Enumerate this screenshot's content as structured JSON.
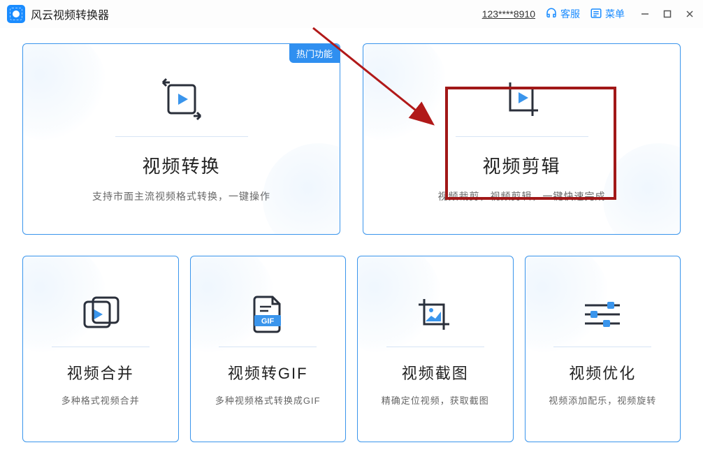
{
  "app": {
    "title": "风云视频转换器"
  },
  "header": {
    "phone": "123****8910",
    "service": "客服",
    "menu": "菜单"
  },
  "cards": {
    "convert": {
      "badge": "热门功能",
      "title": "视频转换",
      "desc": "支持市面主流视频格式转换，一键操作"
    },
    "edit": {
      "title": "视频剪辑",
      "desc": "视频裁剪，视频剪辑，一键快速完成"
    },
    "merge": {
      "title": "视频合并",
      "desc": "多种格式视频合并"
    },
    "gif": {
      "title": "视频转GIF",
      "desc": "多种视频格式转换成GIF",
      "iconLabel": "GIF"
    },
    "screenshot": {
      "title": "视频截图",
      "desc": "精确定位视频，获取截图"
    },
    "optimize": {
      "title": "视频优化",
      "desc": "视频添加配乐，视频旋转"
    }
  }
}
